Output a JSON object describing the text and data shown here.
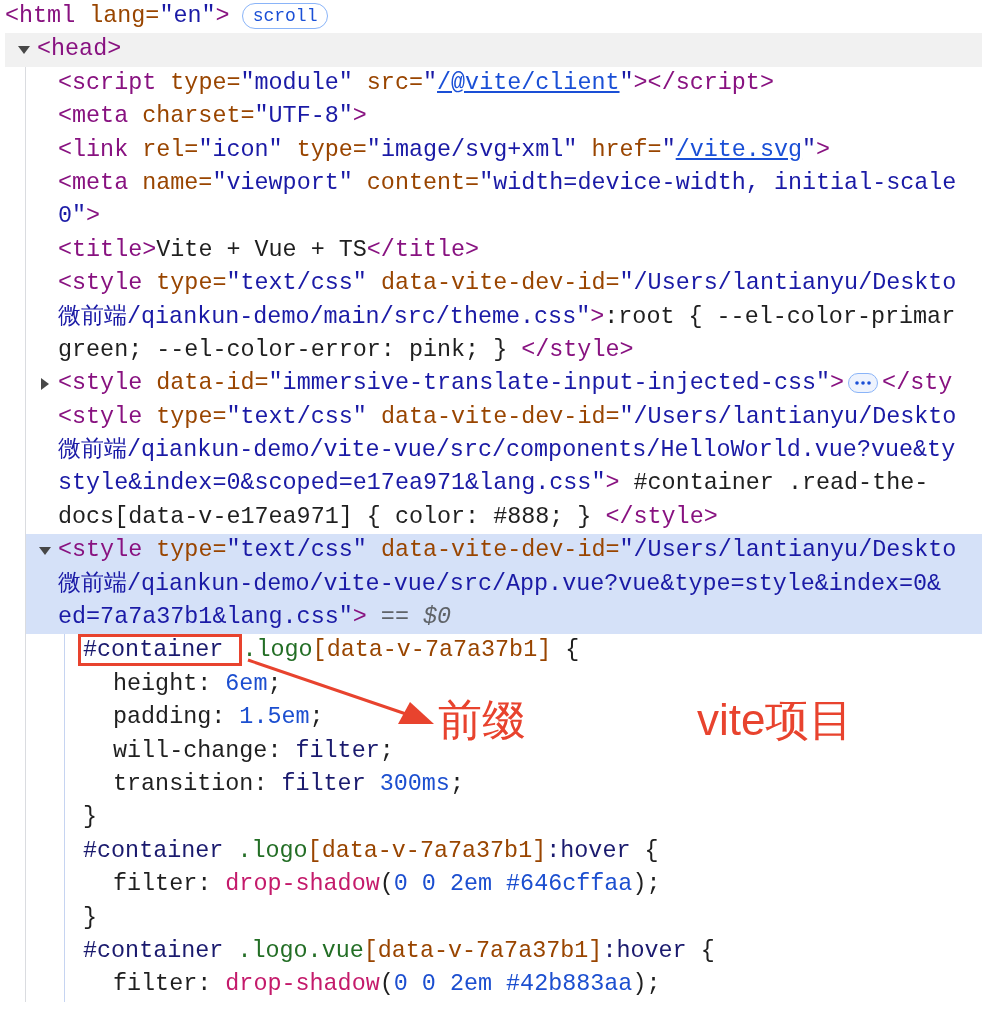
{
  "tree": [
    {
      "kind": "element",
      "selected": false,
      "hovered": false,
      "lines": [
        [
          {
            "kind": "tag",
            "text": "<html"
          },
          {
            "kind": "attr",
            "text": " lang="
          },
          {
            "kind": "value",
            "text": "\"en\""
          },
          {
            "kind": "tag",
            "text": ">"
          },
          {
            "kind": "badge",
            "text": "scroll"
          }
        ]
      ],
      "children": [
        {
          "kind": "element",
          "expanded": true,
          "selected": false,
          "hovered": true,
          "lines": [
            [
              {
                "kind": "tag",
                "text": "<head>"
              }
            ]
          ],
          "children": [
            {
              "kind": "element",
              "selected": false,
              "hovered": false,
              "lines": [
                [
                  {
                    "kind": "tag",
                    "text": "<script"
                  },
                  {
                    "kind": "attr",
                    "text": " type="
                  },
                  {
                    "kind": "value",
                    "text": "\"module\""
                  },
                  {
                    "kind": "attr",
                    "text": " src="
                  },
                  {
                    "kind": "value",
                    "text": "\""
                  },
                  {
                    "kind": "link",
                    "text": "/@vite/client"
                  },
                  {
                    "kind": "value",
                    "text": "\""
                  },
                  {
                    "kind": "tag",
                    "text": "></script>"
                  }
                ]
              ]
            },
            {
              "kind": "element",
              "selected": false,
              "hovered": false,
              "lines": [
                [
                  {
                    "kind": "tag",
                    "text": "<meta"
                  },
                  {
                    "kind": "attr",
                    "text": " charset="
                  },
                  {
                    "kind": "value",
                    "text": "\"UTF-8\""
                  },
                  {
                    "kind": "tag",
                    "text": ">"
                  }
                ]
              ]
            },
            {
              "kind": "element",
              "selected": false,
              "hovered": false,
              "lines": [
                [
                  {
                    "kind": "tag",
                    "text": "<link"
                  },
                  {
                    "kind": "attr",
                    "text": " rel="
                  },
                  {
                    "kind": "value",
                    "text": "\"icon\""
                  },
                  {
                    "kind": "attr",
                    "text": " type="
                  },
                  {
                    "kind": "value",
                    "text": "\"image/svg+xml\""
                  },
                  {
                    "kind": "attr",
                    "text": " href="
                  },
                  {
                    "kind": "value",
                    "text": "\""
                  },
                  {
                    "kind": "link",
                    "text": "/vite.svg"
                  },
                  {
                    "kind": "value",
                    "text": "\""
                  },
                  {
                    "kind": "tag",
                    "text": ">"
                  }
                ]
              ]
            },
            {
              "kind": "element",
              "selected": false,
              "hovered": false,
              "lines": [
                [
                  {
                    "kind": "tag",
                    "text": "<meta"
                  },
                  {
                    "kind": "attr",
                    "text": " name="
                  },
                  {
                    "kind": "value",
                    "text": "\"viewport\""
                  },
                  {
                    "kind": "attr",
                    "text": " content="
                  },
                  {
                    "kind": "value",
                    "text": "\"width=device-width, initial-scale"
                  }
                ],
                [
                  {
                    "kind": "value",
                    "text": "0\""
                  },
                  {
                    "kind": "tag",
                    "text": ">"
                  }
                ]
              ]
            },
            {
              "kind": "element",
              "selected": false,
              "hovered": false,
              "lines": [
                [
                  {
                    "kind": "tag",
                    "text": "<title>"
                  },
                  {
                    "kind": "text",
                    "text": "Vite + Vue + TS"
                  },
                  {
                    "kind": "tag",
                    "text": "</title>"
                  }
                ]
              ]
            },
            {
              "kind": "element",
              "selected": false,
              "hovered": false,
              "lines": [
                [
                  {
                    "kind": "tag",
                    "text": "<style"
                  },
                  {
                    "kind": "attr",
                    "text": " type="
                  },
                  {
                    "kind": "value",
                    "text": "\"text/css\""
                  },
                  {
                    "kind": "attr",
                    "text": " data-vite-dev-id="
                  },
                  {
                    "kind": "value",
                    "text": "\"/Users/lantianyu/Deskto"
                  }
                ],
                [
                  {
                    "kind": "value",
                    "text": "微前端/qiankun-demo/main/src/theme.css\""
                  },
                  {
                    "kind": "tag",
                    "text": ">"
                  },
                  {
                    "kind": "text",
                    "text": ":root { --el-color-primar"
                  }
                ],
                [
                  {
                    "kind": "text",
                    "text": "green; --el-color-error: pink; } "
                  },
                  {
                    "kind": "tag",
                    "text": "</style>"
                  }
                ]
              ]
            },
            {
              "kind": "element",
              "expanded": false,
              "selected": false,
              "hovered": false,
              "lines": [
                [
                  {
                    "kind": "tag",
                    "text": "<style"
                  },
                  {
                    "kind": "attr",
                    "text": " data-id="
                  },
                  {
                    "kind": "value",
                    "text": "\"immersive-translate-input-injected-css\""
                  },
                  {
                    "kind": "tag",
                    "text": ">"
                  },
                  {
                    "kind": "ellipsis"
                  },
                  {
                    "kind": "tag",
                    "text": "</sty"
                  }
                ]
              ]
            },
            {
              "kind": "element",
              "selected": false,
              "hovered": false,
              "lines": [
                [
                  {
                    "kind": "tag",
                    "text": "<style"
                  },
                  {
                    "kind": "attr",
                    "text": " type="
                  },
                  {
                    "kind": "value",
                    "text": "\"text/css\""
                  },
                  {
                    "kind": "attr",
                    "text": " data-vite-dev-id="
                  },
                  {
                    "kind": "value",
                    "text": "\"/Users/lantianyu/Deskto"
                  }
                ],
                [
                  {
                    "kind": "value",
                    "text": "微前端/qiankun-demo/vite-vue/src/components/HelloWorld.vue?vue&ty"
                  }
                ],
                [
                  {
                    "kind": "value",
                    "text": "style&index=0&scoped=e17ea971&lang.css\""
                  },
                  {
                    "kind": "tag",
                    "text": ">"
                  },
                  {
                    "kind": "text",
                    "text": " #container .read-the-"
                  }
                ],
                [
                  {
                    "kind": "text",
                    "text": "docs[data-v-e17ea971] { color: #888; } "
                  },
                  {
                    "kind": "tag",
                    "text": "</style>"
                  }
                ]
              ]
            },
            {
              "kind": "element",
              "expanded": true,
              "selected": true,
              "hovered": false,
              "lines": [
                [
                  {
                    "kind": "tag",
                    "text": "<style"
                  },
                  {
                    "kind": "attr",
                    "text": " type="
                  },
                  {
                    "kind": "value",
                    "text": "\"text/css\""
                  },
                  {
                    "kind": "attr",
                    "text": " data-vite-dev-id="
                  },
                  {
                    "kind": "value",
                    "text": "\"/Users/lantianyu/Deskto"
                  }
                ],
                [
                  {
                    "kind": "value",
                    "text": "微前端/qiankun-demo/vite-vue/src/App.vue?vue&type=style&index=0&"
                  }
                ],
                [
                  {
                    "kind": "value",
                    "text": "ed=7a7a37b1&lang.css\""
                  },
                  {
                    "kind": "tag",
                    "text": ">"
                  },
                  {
                    "kind": "dim",
                    "text": " == "
                  },
                  {
                    "kind": "ref",
                    "text": "$0"
                  }
                ]
              ],
              "children": [
                {
                  "kind": "rule",
                  "lines": [
                    [
                      {
                        "kind": "selector-id",
                        "text": "#container ",
                        "boxed": true
                      },
                      {
                        "kind": "selector-class",
                        "text": ".logo"
                      },
                      {
                        "kind": "selector-attr",
                        "text": "[data-v-7a7a37b1]"
                      },
                      {
                        "kind": "punct",
                        "text": " {"
                      }
                    ]
                  ],
                  "children": [
                    {
                      "kind": "decl",
                      "lines": [
                        [
                          {
                            "kind": "prop",
                            "text": "height"
                          },
                          {
                            "kind": "punct",
                            "text": ": "
                          },
                          {
                            "kind": "number",
                            "text": "6em"
                          },
                          {
                            "kind": "punct",
                            "text": ";"
                          }
                        ]
                      ]
                    },
                    {
                      "kind": "decl",
                      "lines": [
                        [
                          {
                            "kind": "prop",
                            "text": "padding"
                          },
                          {
                            "kind": "punct",
                            "text": ": "
                          },
                          {
                            "kind": "number",
                            "text": "1.5em"
                          },
                          {
                            "kind": "punct",
                            "text": ";"
                          }
                        ]
                      ]
                    },
                    {
                      "kind": "decl",
                      "lines": [
                        [
                          {
                            "kind": "prop",
                            "text": "will-change"
                          },
                          {
                            "kind": "punct",
                            "text": ": "
                          },
                          {
                            "kind": "keyword",
                            "text": "filter"
                          },
                          {
                            "kind": "punct",
                            "text": ";"
                          }
                        ]
                      ]
                    },
                    {
                      "kind": "decl",
                      "lines": [
                        [
                          {
                            "kind": "prop",
                            "text": "transition"
                          },
                          {
                            "kind": "punct",
                            "text": ": "
                          },
                          {
                            "kind": "keyword",
                            "text": "filter "
                          },
                          {
                            "kind": "number",
                            "text": "300ms"
                          },
                          {
                            "kind": "punct",
                            "text": ";"
                          }
                        ]
                      ]
                    }
                  ],
                  "end": [
                    [
                      {
                        "kind": "punct",
                        "text": "}"
                      }
                    ]
                  ]
                },
                {
                  "kind": "rule",
                  "lines": [
                    [
                      {
                        "kind": "selector-id",
                        "text": "#container"
                      },
                      {
                        "kind": "selector-class",
                        "text": " .logo"
                      },
                      {
                        "kind": "selector-attr",
                        "text": "[data-v-7a7a37b1]"
                      },
                      {
                        "kind": "pseudo",
                        "text": ":hover"
                      },
                      {
                        "kind": "punct",
                        "text": " {"
                      }
                    ]
                  ],
                  "children": [
                    {
                      "kind": "decl",
                      "lines": [
                        [
                          {
                            "kind": "prop",
                            "text": "filter"
                          },
                          {
                            "kind": "punct",
                            "text": ": "
                          },
                          {
                            "kind": "function",
                            "text": "drop-shadow"
                          },
                          {
                            "kind": "punct",
                            "text": "("
                          },
                          {
                            "kind": "number",
                            "text": "0 0 2em #646cffaa"
                          },
                          {
                            "kind": "punct",
                            "text": ");"
                          }
                        ]
                      ]
                    }
                  ],
                  "end": [
                    [
                      {
                        "kind": "punct",
                        "text": "}"
                      }
                    ]
                  ]
                },
                {
                  "kind": "rule",
                  "lines": [
                    [
                      {
                        "kind": "selector-id",
                        "text": "#container"
                      },
                      {
                        "kind": "selector-class",
                        "text": " .logo.vue"
                      },
                      {
                        "kind": "selector-attr",
                        "text": "[data-v-7a7a37b1]"
                      },
                      {
                        "kind": "pseudo",
                        "text": ":hover"
                      },
                      {
                        "kind": "punct",
                        "text": " {"
                      }
                    ]
                  ],
                  "children": [
                    {
                      "kind": "decl",
                      "lines": [
                        [
                          {
                            "kind": "prop",
                            "text": "filter"
                          },
                          {
                            "kind": "punct",
                            "text": ": "
                          },
                          {
                            "kind": "function",
                            "text": "drop-shadow"
                          },
                          {
                            "kind": "punct",
                            "text": "("
                          },
                          {
                            "kind": "number",
                            "text": "0 0 2em #42b883aa"
                          },
                          {
                            "kind": "punct",
                            "text": ");"
                          }
                        ]
                      ]
                    }
                  ]
                }
              ]
            }
          ]
        }
      ]
    }
  ],
  "annotations": [
    {
      "text": "前缀"
    },
    {
      "text": "vite项目"
    }
  ]
}
